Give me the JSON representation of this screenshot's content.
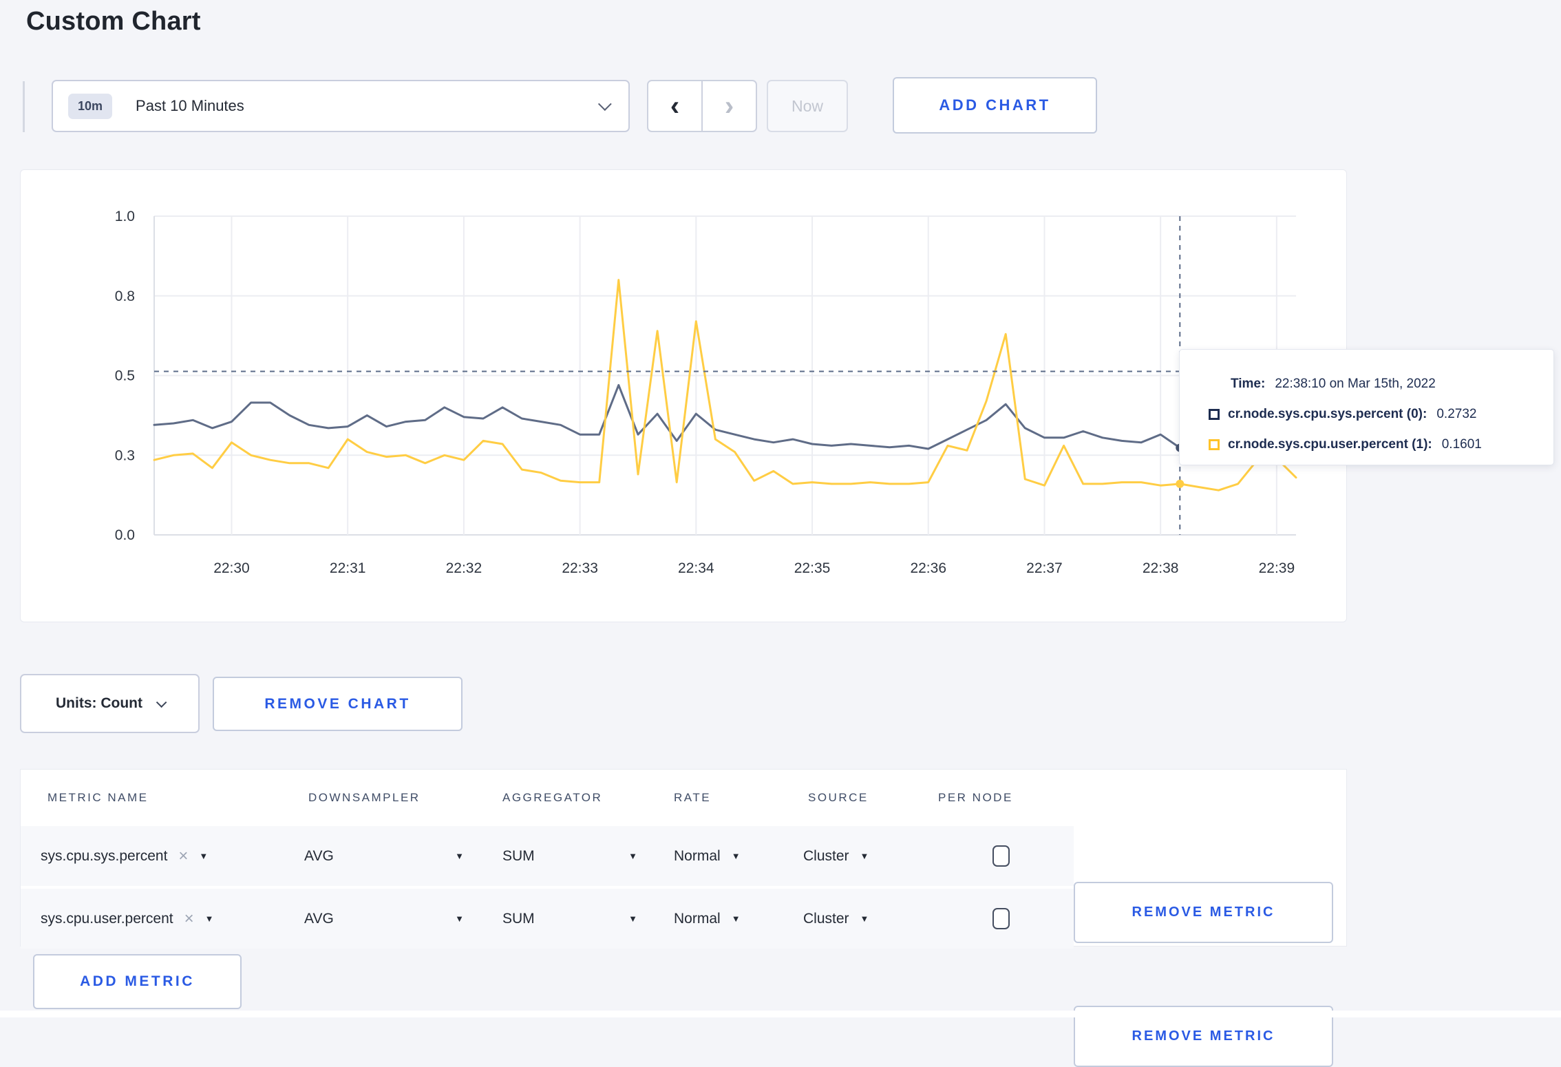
{
  "page": {
    "title": "Custom Chart"
  },
  "icons": {
    "prev": "‹",
    "next": "›",
    "caret": "▼",
    "close": "×"
  },
  "toolbar": {
    "range_badge": "10m",
    "range_label": "Past 10 Minutes",
    "now_label": "Now",
    "add_chart_label": "ADD CHART"
  },
  "chart_footer": {
    "units_label": "Units: Count",
    "remove_chart_label": "REMOVE CHART"
  },
  "tooltip": {
    "time_label": "Time:",
    "time_value": "22:38:10 on Mar 15th, 2022",
    "rows": [
      {
        "label": "cr.node.sys.cpu.sys.percent (0):",
        "value": "0.2732",
        "color": "#1d2c50"
      },
      {
        "label": "cr.node.sys.cpu.user.percent (1):",
        "value": "0.1601",
        "color": "#ffc329"
      }
    ]
  },
  "chart_data": {
    "type": "line",
    "title": "",
    "xlabel": "",
    "ylabel": "",
    "ylim": [
      0,
      1
    ],
    "grid": true,
    "x_start": "22:29:20",
    "x_end": "22:39:10",
    "point_interval_s": 10,
    "x_tick_labels": [
      "22:30",
      "22:31",
      "22:32",
      "22:33",
      "22:34",
      "22:35",
      "22:36",
      "22:37",
      "22:38",
      "22:39"
    ],
    "x_tick_offsets_s": [
      40,
      100,
      160,
      220,
      280,
      340,
      400,
      460,
      520,
      580
    ],
    "y_tick_labels": [
      "0.0",
      "0.3",
      "0.5",
      "0.8",
      "1.0"
    ],
    "y_tick_values": [
      0,
      0.25,
      0.5,
      0.75,
      1.0
    ],
    "crosshair": {
      "time": "22:38:10",
      "offset_s": 530,
      "y_value": 0.513
    },
    "series": [
      {
        "name": "cr.node.sys.cpu.sys.percent (0)",
        "color": "#5f6c87",
        "hover_value": 0.2732,
        "values": [
          0.345,
          0.35,
          0.36,
          0.335,
          0.355,
          0.415,
          0.415,
          0.375,
          0.345,
          0.335,
          0.34,
          0.375,
          0.34,
          0.355,
          0.36,
          0.4,
          0.37,
          0.365,
          0.4,
          0.365,
          0.355,
          0.345,
          0.315,
          0.315,
          0.47,
          0.315,
          0.38,
          0.295,
          0.38,
          0.33,
          0.315,
          0.3,
          0.29,
          0.3,
          0.285,
          0.28,
          0.285,
          0.28,
          0.275,
          0.28,
          0.27,
          0.3,
          0.33,
          0.36,
          0.41,
          0.335,
          0.305,
          0.305,
          0.325,
          0.305,
          0.295,
          0.29,
          0.315,
          0.2732,
          0.3,
          0.31,
          0.3,
          0.295,
          0.31,
          0.27
        ]
      },
      {
        "name": "cr.node.sys.cpu.user.percent (1)",
        "color": "#ffcd44",
        "hover_value": 0.1601,
        "values": [
          0.235,
          0.25,
          0.255,
          0.21,
          0.29,
          0.25,
          0.235,
          0.225,
          0.225,
          0.21,
          0.3,
          0.26,
          0.245,
          0.25,
          0.225,
          0.25,
          0.235,
          0.295,
          0.285,
          0.205,
          0.195,
          0.17,
          0.165,
          0.165,
          0.8,
          0.19,
          0.64,
          0.165,
          0.67,
          0.3,
          0.26,
          0.17,
          0.2,
          0.16,
          0.165,
          0.16,
          0.16,
          0.165,
          0.16,
          0.16,
          0.165,
          0.28,
          0.265,
          0.42,
          0.63,
          0.175,
          0.155,
          0.28,
          0.16,
          0.16,
          0.165,
          0.165,
          0.155,
          0.1601,
          0.15,
          0.14,
          0.16,
          0.235,
          0.24,
          0.18
        ]
      }
    ]
  },
  "metrics": {
    "headers": [
      "METRIC NAME",
      "DOWNSAMPLER",
      "AGGREGATOR",
      "RATE",
      "SOURCE",
      "PER NODE"
    ],
    "rows": [
      {
        "metric": "sys.cpu.sys.percent",
        "downsampler": "AVG",
        "aggregator": "SUM",
        "rate": "Normal",
        "source": "Cluster",
        "per_node_checked": false,
        "remove_label": "REMOVE METRIC"
      },
      {
        "metric": "sys.cpu.user.percent",
        "downsampler": "AVG",
        "aggregator": "SUM",
        "rate": "Normal",
        "source": "Cluster",
        "per_node_checked": false,
        "remove_label": "REMOVE METRIC"
      }
    ],
    "add_metric_label": "ADD METRIC"
  }
}
